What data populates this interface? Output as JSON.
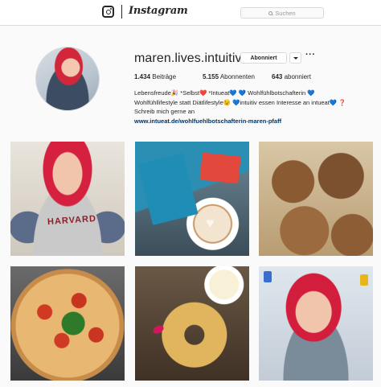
{
  "nav": {
    "wordmark": "Instagram",
    "search_placeholder": "Suchen"
  },
  "profile": {
    "username": "maren.lives.intuitive",
    "follow_label": "Abonniert",
    "more_label": "···",
    "stats": {
      "posts_count": "1.434",
      "posts_label": " Beiträge",
      "followers_count": "5.155",
      "followers_label": " Abonnenten",
      "following_count": "643",
      "following_label": " abonniert"
    },
    "bio": {
      "line1": "Lebensfreude🎉 *Selbst❤️ *Intueat💙 💙 Wohlfühlbotschafterin 💙",
      "line2": "Wohlfühllifestyle statt Diätlifestyle😉 💙intuitiv essen Interesse an intueat💙 ❓",
      "line3": "Schreib mich gerne an",
      "link": "www.intueat.de/wohlfuehlbotschafterin-maren-pfaff"
    }
  },
  "posts": {
    "p1_text": "HARVARD"
  },
  "colors": {
    "link": "#003569",
    "border": "#dbdbdb",
    "background": "#fafafa"
  }
}
